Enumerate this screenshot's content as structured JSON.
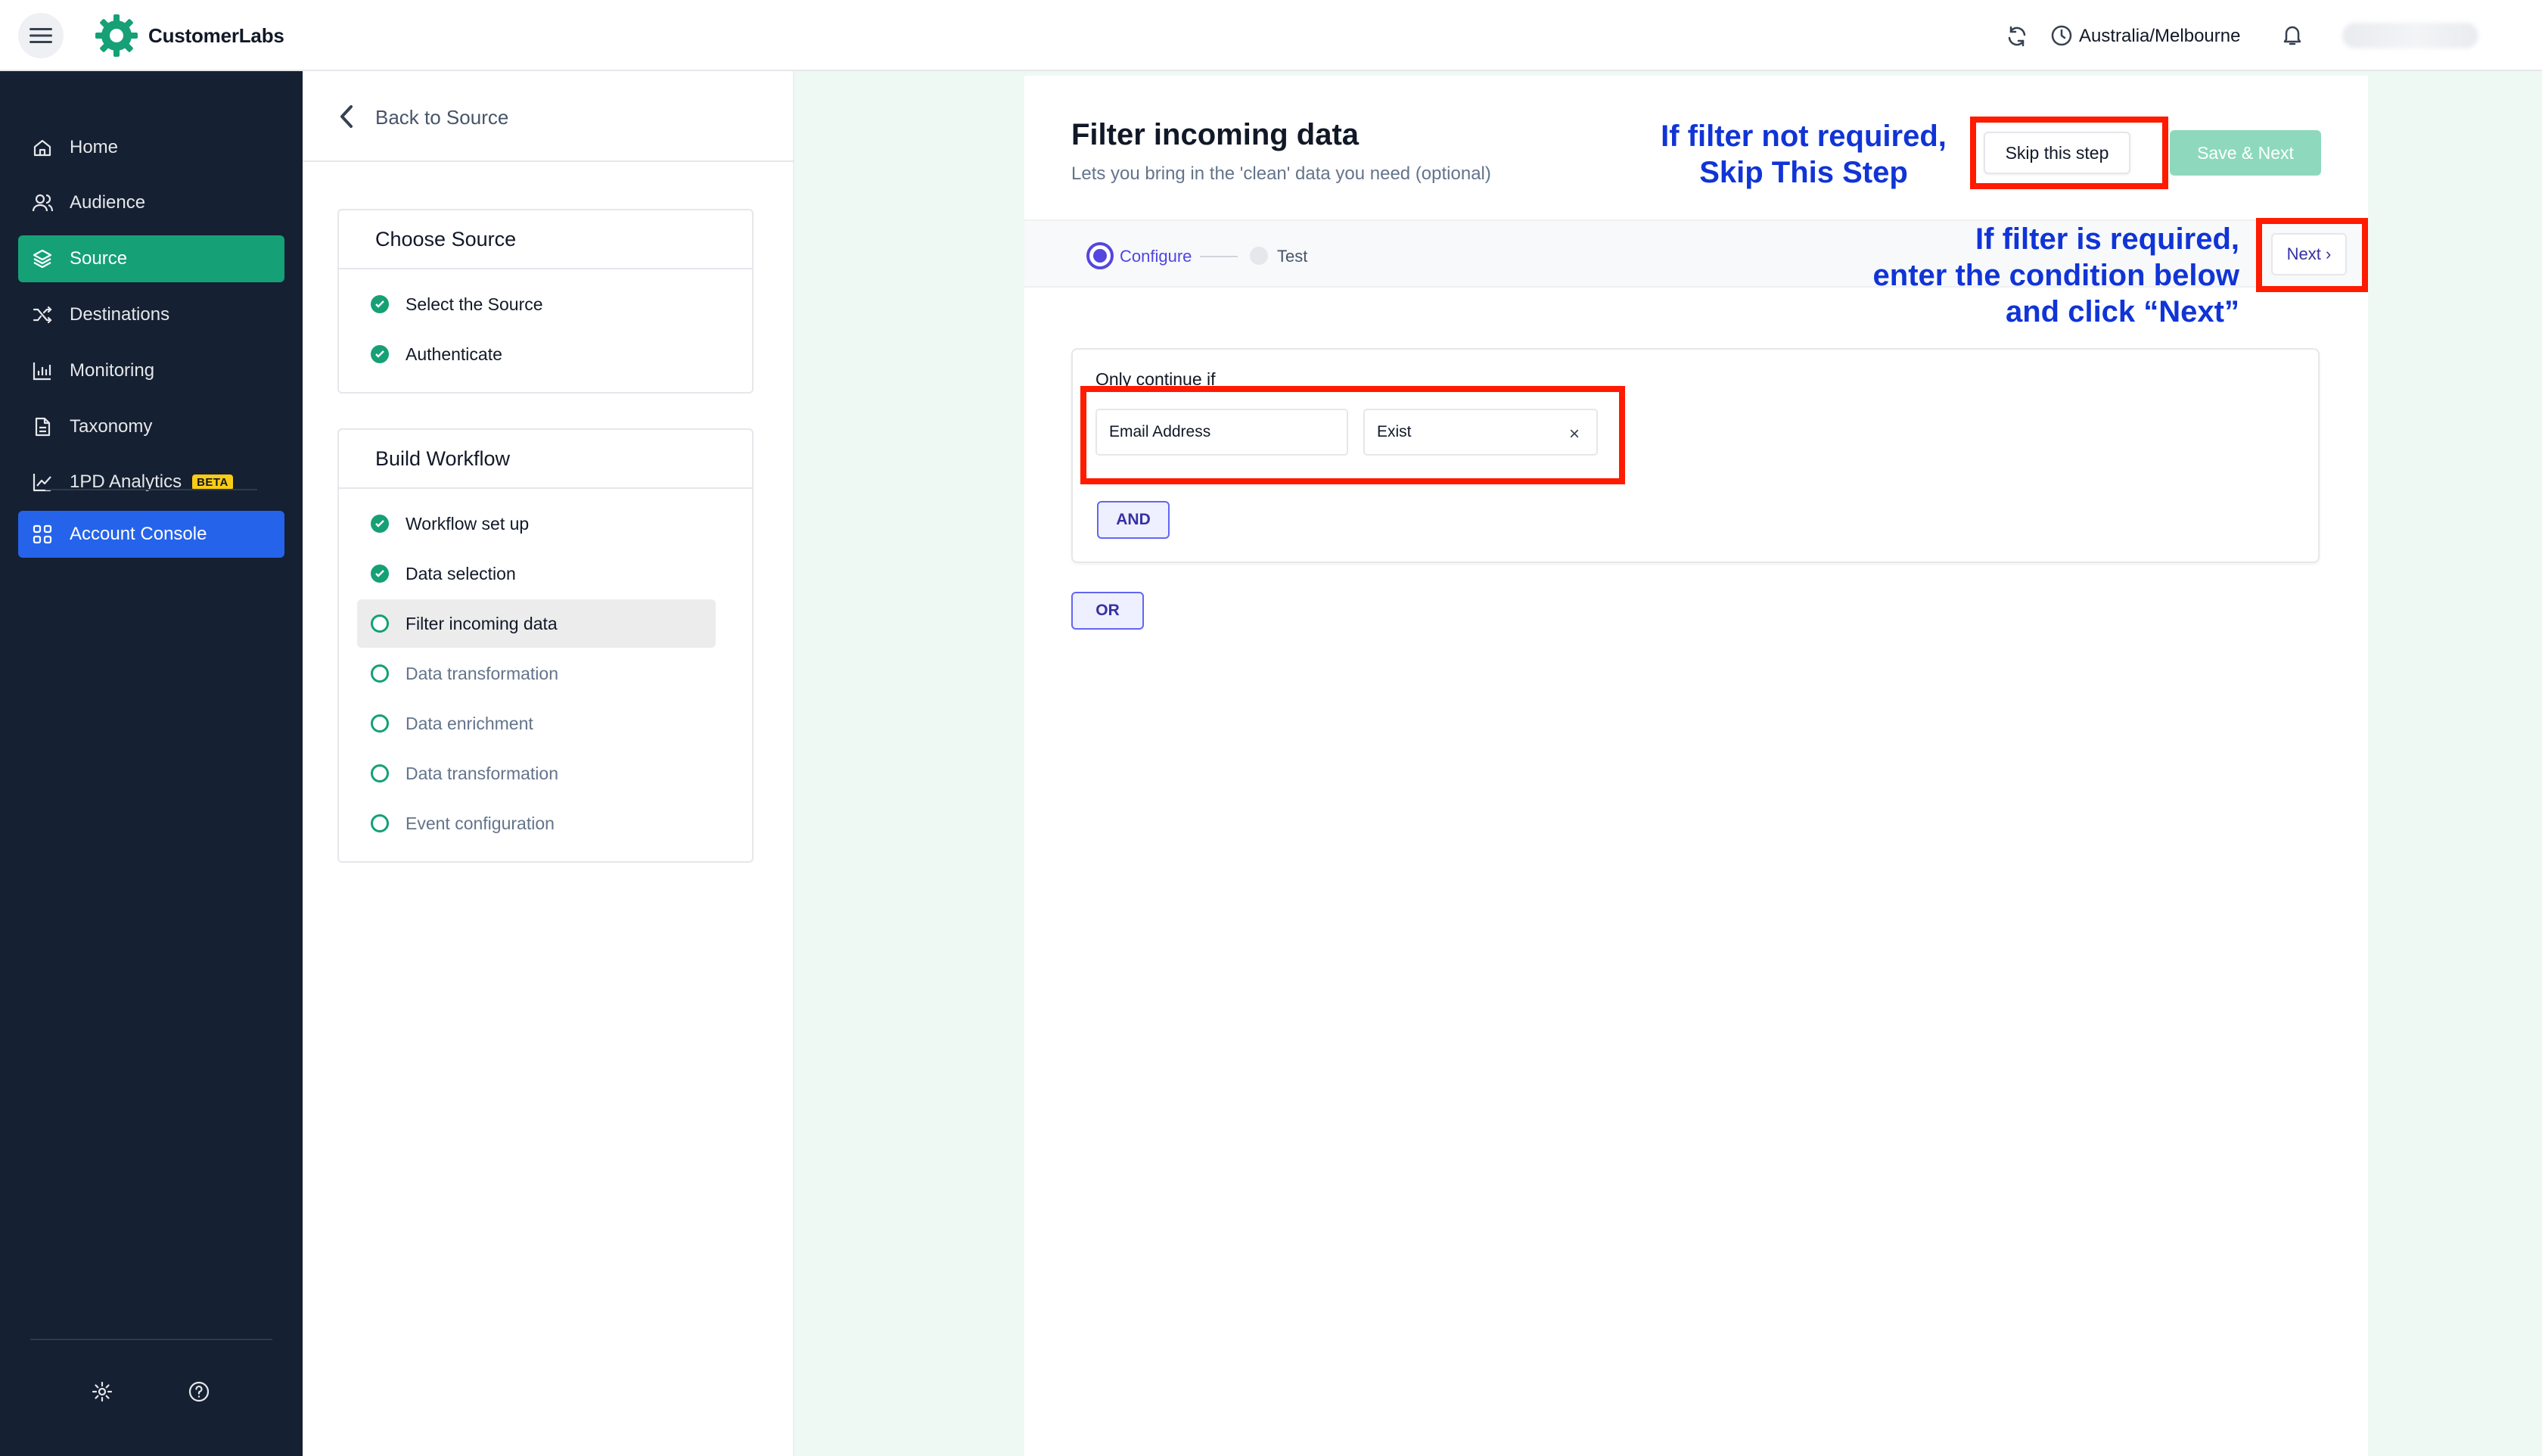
{
  "header": {
    "app_name": "CustomerLabs",
    "timezone": "Australia/Melbourne"
  },
  "nav": {
    "items": [
      {
        "label": "Home",
        "icon": "home-icon"
      },
      {
        "label": "Audience",
        "icon": "users-icon"
      },
      {
        "label": "Source",
        "icon": "layers-icon",
        "active": true
      },
      {
        "label": "Destinations",
        "icon": "shuffle-icon"
      },
      {
        "label": "Monitoring",
        "icon": "bar-chart-icon"
      },
      {
        "label": "Taxonomy",
        "icon": "document-icon"
      },
      {
        "label": "1PD Analytics",
        "icon": "line-chart-icon",
        "badge": "BETA"
      }
    ],
    "console": {
      "label": "Account Console",
      "icon": "grid-icon"
    }
  },
  "panel": {
    "back_label": "Back to Source",
    "choose_source": {
      "title": "Choose Source",
      "steps": [
        "Select the Source",
        "Authenticate"
      ]
    },
    "build_workflow": {
      "title": "Build Workflow",
      "steps": [
        {
          "label": "Workflow set up",
          "status": "done"
        },
        {
          "label": "Data selection",
          "status": "done"
        },
        {
          "label": "Filter incoming data",
          "status": "current"
        },
        {
          "label": "Data transformation",
          "status": "todo"
        },
        {
          "label": "Data enrichment",
          "status": "todo"
        },
        {
          "label": "Data transformation",
          "status": "todo"
        },
        {
          "label": "Event configuration",
          "status": "todo"
        }
      ]
    }
  },
  "main": {
    "title": "Filter incoming data",
    "subtitle": "Lets you bring in the 'clean' data you need (optional)",
    "skip_label": "Skip this step",
    "save_next_label": "Save & Next",
    "stepper": {
      "step1": "Configure",
      "step2": "Test"
    },
    "next_label": "Next ›",
    "filter": {
      "heading": "Only continue if",
      "field_value": "Email Address",
      "operator_value": "Exist",
      "clear_symbol": "×",
      "and_label": "AND",
      "or_label": "OR"
    }
  },
  "annotations": {
    "skip_note_line1": "If filter not required,",
    "skip_note_line2": "Skip This Step",
    "next_note_line1": "If filter is required,",
    "next_note_line2": "enter the condition below",
    "next_note_line3": "and click “Next”"
  },
  "colors": {
    "sidebar_bg": "#152032",
    "active_nav": "#15a076",
    "console_nav": "#2563eb",
    "accent": "#5546e0",
    "highlight": "#ff1a00",
    "note_text": "#1034d6"
  }
}
